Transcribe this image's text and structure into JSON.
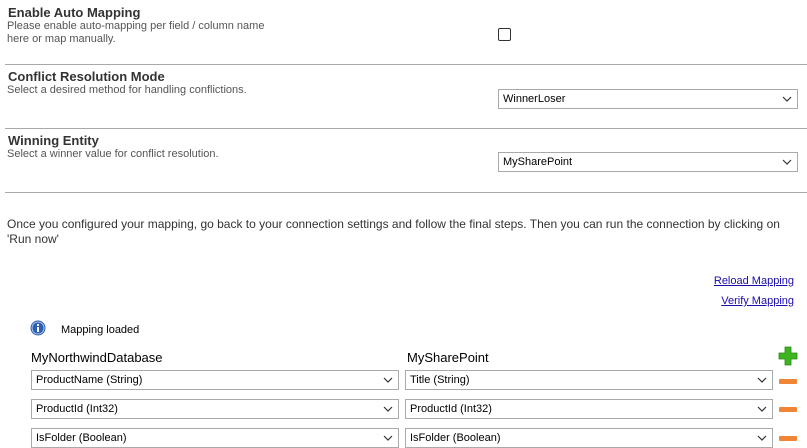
{
  "auto_mapping": {
    "title": "Enable Auto Mapping",
    "desc_line1": "Please enable auto-mapping per field / column name",
    "desc_line2": "here or map manually."
  },
  "conflict_mode": {
    "title": "Conflict Resolution Mode",
    "desc": "Select a desired method for handling conflictions.",
    "selected": "WinnerLoser"
  },
  "winning_entity": {
    "title": "Winning Entity",
    "desc": "Select a winner value for conflict resolution.",
    "selected": "MySharePoint"
  },
  "info": {
    "line1": "Once you configured your mapping, go back to your connection settings and follow the final steps. Then you can run the connection by clicking on",
    "line2": "'Run now'"
  },
  "links": {
    "reload": "Reload Mapping",
    "verify": "Verify Mapping"
  },
  "status": {
    "text": "Mapping loaded"
  },
  "mapping": {
    "left_header": "MyNorthwindDatabase",
    "right_header": "MySharePoint",
    "rows": [
      {
        "left": "ProductName (String)",
        "right": "Title (String)"
      },
      {
        "left": "ProductId (Int32)",
        "right": "ProductId (Int32)"
      },
      {
        "left": "IsFolder (Boolean)",
        "right": "IsFolder (Boolean)"
      }
    ]
  },
  "colors": {
    "add_green": "#3cb521",
    "remove_orange": "#f08535",
    "info_blue": "#2f5fb3"
  }
}
